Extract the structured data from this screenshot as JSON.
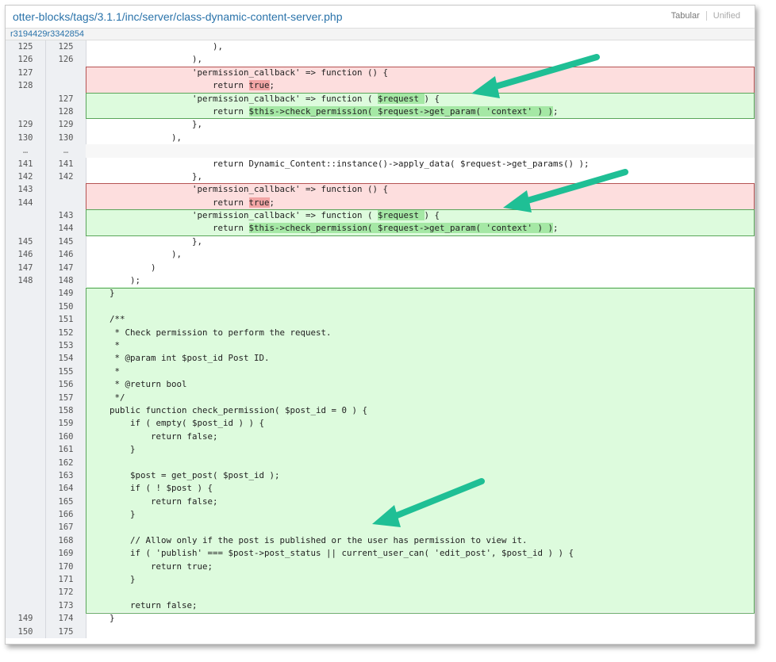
{
  "header": {
    "file_path": "otter-blocks/tags/3.1.1/inc/server/class-dynamic-content-server.php",
    "revision": "r3194429r3342854",
    "view_tabular": "Tabular",
    "view_unified": "Unified"
  },
  "diff": [
    {
      "type": "ctx",
      "old": "125",
      "new": "125",
      "segs": [
        {
          "t": "                        ),"
        }
      ]
    },
    {
      "type": "ctx",
      "old": "126",
      "new": "126",
      "segs": [
        {
          "t": "                    ),"
        }
      ]
    },
    {
      "type": "del",
      "old": "127",
      "new": "",
      "segs": [
        {
          "t": "                    'permission_callback' => function () {"
        }
      ]
    },
    {
      "type": "del",
      "old": "128",
      "new": "",
      "segs": [
        {
          "t": "                        return "
        },
        {
          "t": "true",
          "h": "del"
        },
        {
          "t": ";"
        }
      ]
    },
    {
      "type": "ins",
      "old": "",
      "new": "127",
      "segs": [
        {
          "t": "                    'permission_callback' => function ( "
        },
        {
          "t": "$request ",
          "h": "ins"
        },
        {
          "t": ") {"
        }
      ]
    },
    {
      "type": "ins",
      "old": "",
      "new": "128",
      "segs": [
        {
          "t": "                        return "
        },
        {
          "t": "$this->check_permission( $request->get_param( 'context' ) )",
          "h": "ins"
        },
        {
          "t": ";"
        }
      ]
    },
    {
      "type": "ctx",
      "old": "129",
      "new": "129",
      "segs": [
        {
          "t": "                    },"
        }
      ]
    },
    {
      "type": "ctx",
      "old": "130",
      "new": "130",
      "segs": [
        {
          "t": "                ),"
        }
      ]
    },
    {
      "type": "skip",
      "old": "…",
      "new": "…",
      "segs": [
        {
          "t": ""
        }
      ]
    },
    {
      "type": "ctx",
      "old": "141",
      "new": "141",
      "segs": [
        {
          "t": "                        return Dynamic_Content::instance()->apply_data( $request->get_params() );"
        }
      ]
    },
    {
      "type": "ctx",
      "old": "142",
      "new": "142",
      "segs": [
        {
          "t": "                    },"
        }
      ]
    },
    {
      "type": "del",
      "old": "143",
      "new": "",
      "segs": [
        {
          "t": "                    'permission_callback' => function () {"
        }
      ]
    },
    {
      "type": "del",
      "old": "144",
      "new": "",
      "segs": [
        {
          "t": "                        return "
        },
        {
          "t": "true",
          "h": "del"
        },
        {
          "t": ";"
        }
      ]
    },
    {
      "type": "ins",
      "old": "",
      "new": "143",
      "segs": [
        {
          "t": "                    'permission_callback' => function ( "
        },
        {
          "t": "$request ",
          "h": "ins"
        },
        {
          "t": ") {"
        }
      ]
    },
    {
      "type": "ins",
      "old": "",
      "new": "144",
      "segs": [
        {
          "t": "                        return "
        },
        {
          "t": "$this->check_permission( $request->get_param( 'context' ) )",
          "h": "ins"
        },
        {
          "t": ";"
        }
      ]
    },
    {
      "type": "ctx",
      "old": "145",
      "new": "145",
      "segs": [
        {
          "t": "                    },"
        }
      ]
    },
    {
      "type": "ctx",
      "old": "146",
      "new": "146",
      "segs": [
        {
          "t": "                ),"
        }
      ]
    },
    {
      "type": "ctx",
      "old": "147",
      "new": "147",
      "segs": [
        {
          "t": "            )"
        }
      ]
    },
    {
      "type": "ctx",
      "old": "148",
      "new": "148",
      "segs": [
        {
          "t": "        );"
        }
      ]
    },
    {
      "type": "ins",
      "old": "",
      "new": "149",
      "segs": [
        {
          "t": "    }"
        }
      ]
    },
    {
      "type": "ins",
      "old": "",
      "new": "150",
      "segs": [
        {
          "t": ""
        }
      ]
    },
    {
      "type": "ins",
      "old": "",
      "new": "151",
      "segs": [
        {
          "t": "    /**"
        }
      ]
    },
    {
      "type": "ins",
      "old": "",
      "new": "152",
      "segs": [
        {
          "t": "     * Check permission to perform the request."
        }
      ]
    },
    {
      "type": "ins",
      "old": "",
      "new": "153",
      "segs": [
        {
          "t": "     *"
        }
      ]
    },
    {
      "type": "ins",
      "old": "",
      "new": "154",
      "segs": [
        {
          "t": "     * @param int $post_id Post ID."
        }
      ]
    },
    {
      "type": "ins",
      "old": "",
      "new": "155",
      "segs": [
        {
          "t": "     *"
        }
      ]
    },
    {
      "type": "ins",
      "old": "",
      "new": "156",
      "segs": [
        {
          "t": "     * @return bool"
        }
      ]
    },
    {
      "type": "ins",
      "old": "",
      "new": "157",
      "segs": [
        {
          "t": "     */"
        }
      ]
    },
    {
      "type": "ins",
      "old": "",
      "new": "158",
      "segs": [
        {
          "t": "    public function check_permission( $post_id = 0 ) {"
        }
      ]
    },
    {
      "type": "ins",
      "old": "",
      "new": "159",
      "segs": [
        {
          "t": "        if ( empty( $post_id ) ) {"
        }
      ]
    },
    {
      "type": "ins",
      "old": "",
      "new": "160",
      "segs": [
        {
          "t": "            return false;"
        }
      ]
    },
    {
      "type": "ins",
      "old": "",
      "new": "161",
      "segs": [
        {
          "t": "        }"
        }
      ]
    },
    {
      "type": "ins",
      "old": "",
      "new": "162",
      "segs": [
        {
          "t": ""
        }
      ]
    },
    {
      "type": "ins",
      "old": "",
      "new": "163",
      "segs": [
        {
          "t": "        $post = get_post( $post_id );"
        }
      ]
    },
    {
      "type": "ins",
      "old": "",
      "new": "164",
      "segs": [
        {
          "t": "        if ( ! $post ) {"
        }
      ]
    },
    {
      "type": "ins",
      "old": "",
      "new": "165",
      "segs": [
        {
          "t": "            return false;"
        }
      ]
    },
    {
      "type": "ins",
      "old": "",
      "new": "166",
      "segs": [
        {
          "t": "        }"
        }
      ]
    },
    {
      "type": "ins",
      "old": "",
      "new": "167",
      "segs": [
        {
          "t": ""
        }
      ]
    },
    {
      "type": "ins",
      "old": "",
      "new": "168",
      "segs": [
        {
          "t": "        // Allow only if the post is published or the user has permission to view it."
        }
      ]
    },
    {
      "type": "ins",
      "old": "",
      "new": "169",
      "segs": [
        {
          "t": "        if ( 'publish' === $post->post_status || current_user_can( 'edit_post', $post_id ) ) {"
        }
      ]
    },
    {
      "type": "ins",
      "old": "",
      "new": "170",
      "segs": [
        {
          "t": "            return true;"
        }
      ]
    },
    {
      "type": "ins",
      "old": "",
      "new": "171",
      "segs": [
        {
          "t": "        }"
        }
      ]
    },
    {
      "type": "ins",
      "old": "",
      "new": "172",
      "segs": [
        {
          "t": ""
        }
      ]
    },
    {
      "type": "ins",
      "old": "",
      "new": "173",
      "segs": [
        {
          "t": "        return false;"
        }
      ]
    },
    {
      "type": "ctx",
      "old": "149",
      "new": "174",
      "segs": [
        {
          "t": "    }"
        }
      ]
    },
    {
      "type": "ctx",
      "old": "150",
      "new": "175",
      "segs": [
        {
          "t": ""
        }
      ]
    }
  ],
  "colors": {
    "deleted_bg": "#fddede",
    "inserted_bg": "#ddfbdd",
    "annotation_arrow": "#1fbf95"
  }
}
